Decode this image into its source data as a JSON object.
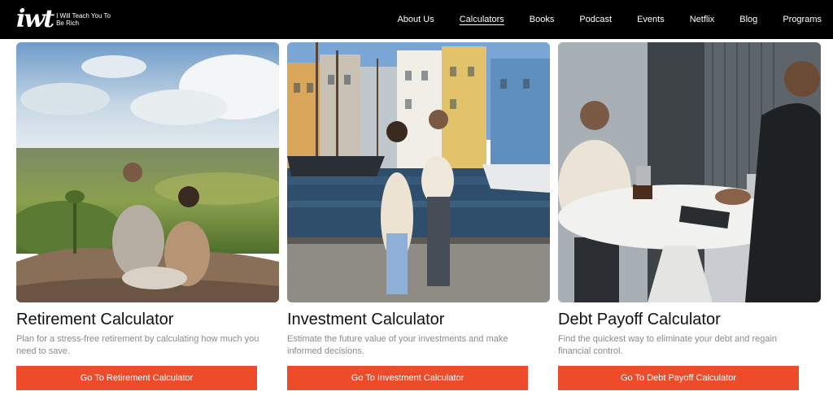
{
  "header": {
    "logo": {
      "mark": "iwt",
      "text": "I Will Teach You To Be Rich"
    },
    "nav": [
      {
        "label": "About Us",
        "active": false
      },
      {
        "label": "Calculators",
        "active": true
      },
      {
        "label": "Books",
        "active": false
      },
      {
        "label": "Podcast",
        "active": false
      },
      {
        "label": "Events",
        "active": false
      },
      {
        "label": "Netflix",
        "active": false
      },
      {
        "label": "Blog",
        "active": false
      },
      {
        "label": "Programs",
        "active": false
      }
    ]
  },
  "cards": [
    {
      "title": "Retirement Calculator",
      "description": "Plan for a stress-free retirement by calculating how much you need to save.",
      "button_label": "Go To Retirement Calculator"
    },
    {
      "title": "Investment Calculator",
      "description": "Estimate the future value of your investments and make informed decisions.",
      "button_label": "Go To Investment Calculator"
    },
    {
      "title": "Debt Payoff Calculator",
      "description": "Find the quickest way to eliminate your debt and regain financial control.",
      "button_label": "Go To Debt Payoff Calculator"
    }
  ],
  "colors": {
    "header_bg": "#000000",
    "button_bg": "#ee4b2b",
    "title": "#111111",
    "description": "#8a8a8a"
  }
}
